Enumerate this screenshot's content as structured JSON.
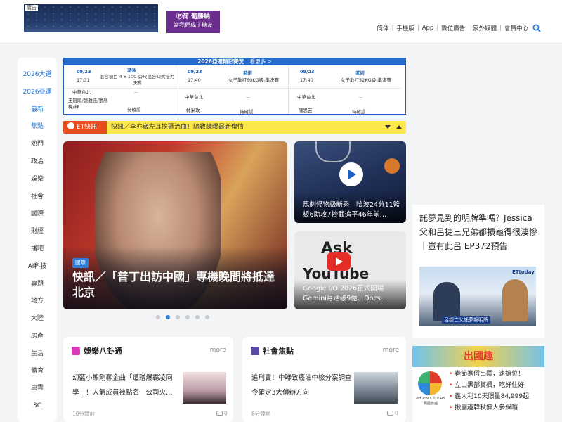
{
  "header": {
    "banner1_tag": "廣告",
    "banner2_line1": "Ⓟ荷 葡勝納",
    "banner2_line2": "當我們成了糖友",
    "nav": [
      "简体",
      "手機版",
      "App",
      "數位廣告",
      "家外媒體",
      "會員中心"
    ]
  },
  "leftnav": {
    "items": [
      "2026大選",
      "2026亞運",
      "最新",
      "焦點",
      "熱門",
      "政治",
      "娛樂",
      "社會",
      "國際",
      "財經",
      "播吧",
      "AI科技",
      "專題",
      "地方",
      "大陸",
      "房產",
      "生活",
      "體育",
      "車雲",
      "3C"
    ]
  },
  "schedule": {
    "title": "2026亞運精彩賽況",
    "more": "看更多 >",
    "cols": [
      {
        "date": "09/23",
        "time": "17:31",
        "sport": "游泳",
        "event": "混合項目 4 x 100 公尺混合四式接力決賽",
        "team": "中華台北",
        "score": "--",
        "athletes": "王冠閎/張雅佳/張喬禕/梓",
        "status": "待確認"
      },
      {
        "date": "09/23",
        "time": "17:40",
        "sport": "武術",
        "event": "女子散打60KG級-準決賽",
        "team": "中華台北",
        "score": "--",
        "athletes": "林采玫",
        "status": "待確認"
      },
      {
        "date": "09/23",
        "time": "17:40",
        "sport": "武術",
        "event": "女子散打52KG級-準決賽",
        "team": "中華台北",
        "score": "--",
        "athletes": "陳思芸",
        "status": "待確認"
      }
    ]
  },
  "ticker": {
    "badge": "ET快訊",
    "text": "快訊／李亦崴左耳挨砸流血！總教練曝最新傷情"
  },
  "hero": {
    "tag": "國際",
    "title": "快訊／「普丁出訪中國」專機晚間將抵達北京"
  },
  "cards": {
    "nba_title": "馬刺怪物級新秀　哈波24分11籃板6助攻7抄截追平46年前…",
    "yt_ask": "Ask",
    "yt_word": "YouTube",
    "yt_title": "Google I/O 2026正式開場　Gemini月活破9億、Docs…"
  },
  "promo": {
    "text": "託夢見到的明牌準嗎？Jessica父和呂捷三兄弟都損龜得很淒慘｜豈有此呂 EP372預告",
    "img_logo": "ETtoday",
    "img_caption": "呂捷亡父託夢報明牌"
  },
  "ad": {
    "title": "出國趣",
    "brand": "PHOENIX TOURS 鳳凰旅遊",
    "items": [
      "春節寒假出國，速搶位！",
      "立山黑部賞楓，吃好住好",
      "義大利10天限量84,999起",
      "揪團趣韓秋無人參保囉"
    ]
  },
  "sections": {
    "ent_title": "娛樂八卦通",
    "soc_title": "社會焦點",
    "more": "more",
    "ent_text": "幻藍小熊剛奪金曲「遭贈爆霸凌同學」！人氣成員被點名　公司火…",
    "soc_text": "追刑責！中聯致癌油中檢分案調查　今確定3大偵辦方向",
    "ent_time": "10分鐘前",
    "soc_time": "8分鐘前",
    "ent_comments": "0",
    "soc_comments": "0"
  },
  "colors": {
    "accent_blue": "#2468c8",
    "ticker_yellow": "#fde74c",
    "ticker_red": "#e74c1c",
    "ent_pink": "#d93cb8",
    "soc_purple": "#5a4aa8"
  }
}
